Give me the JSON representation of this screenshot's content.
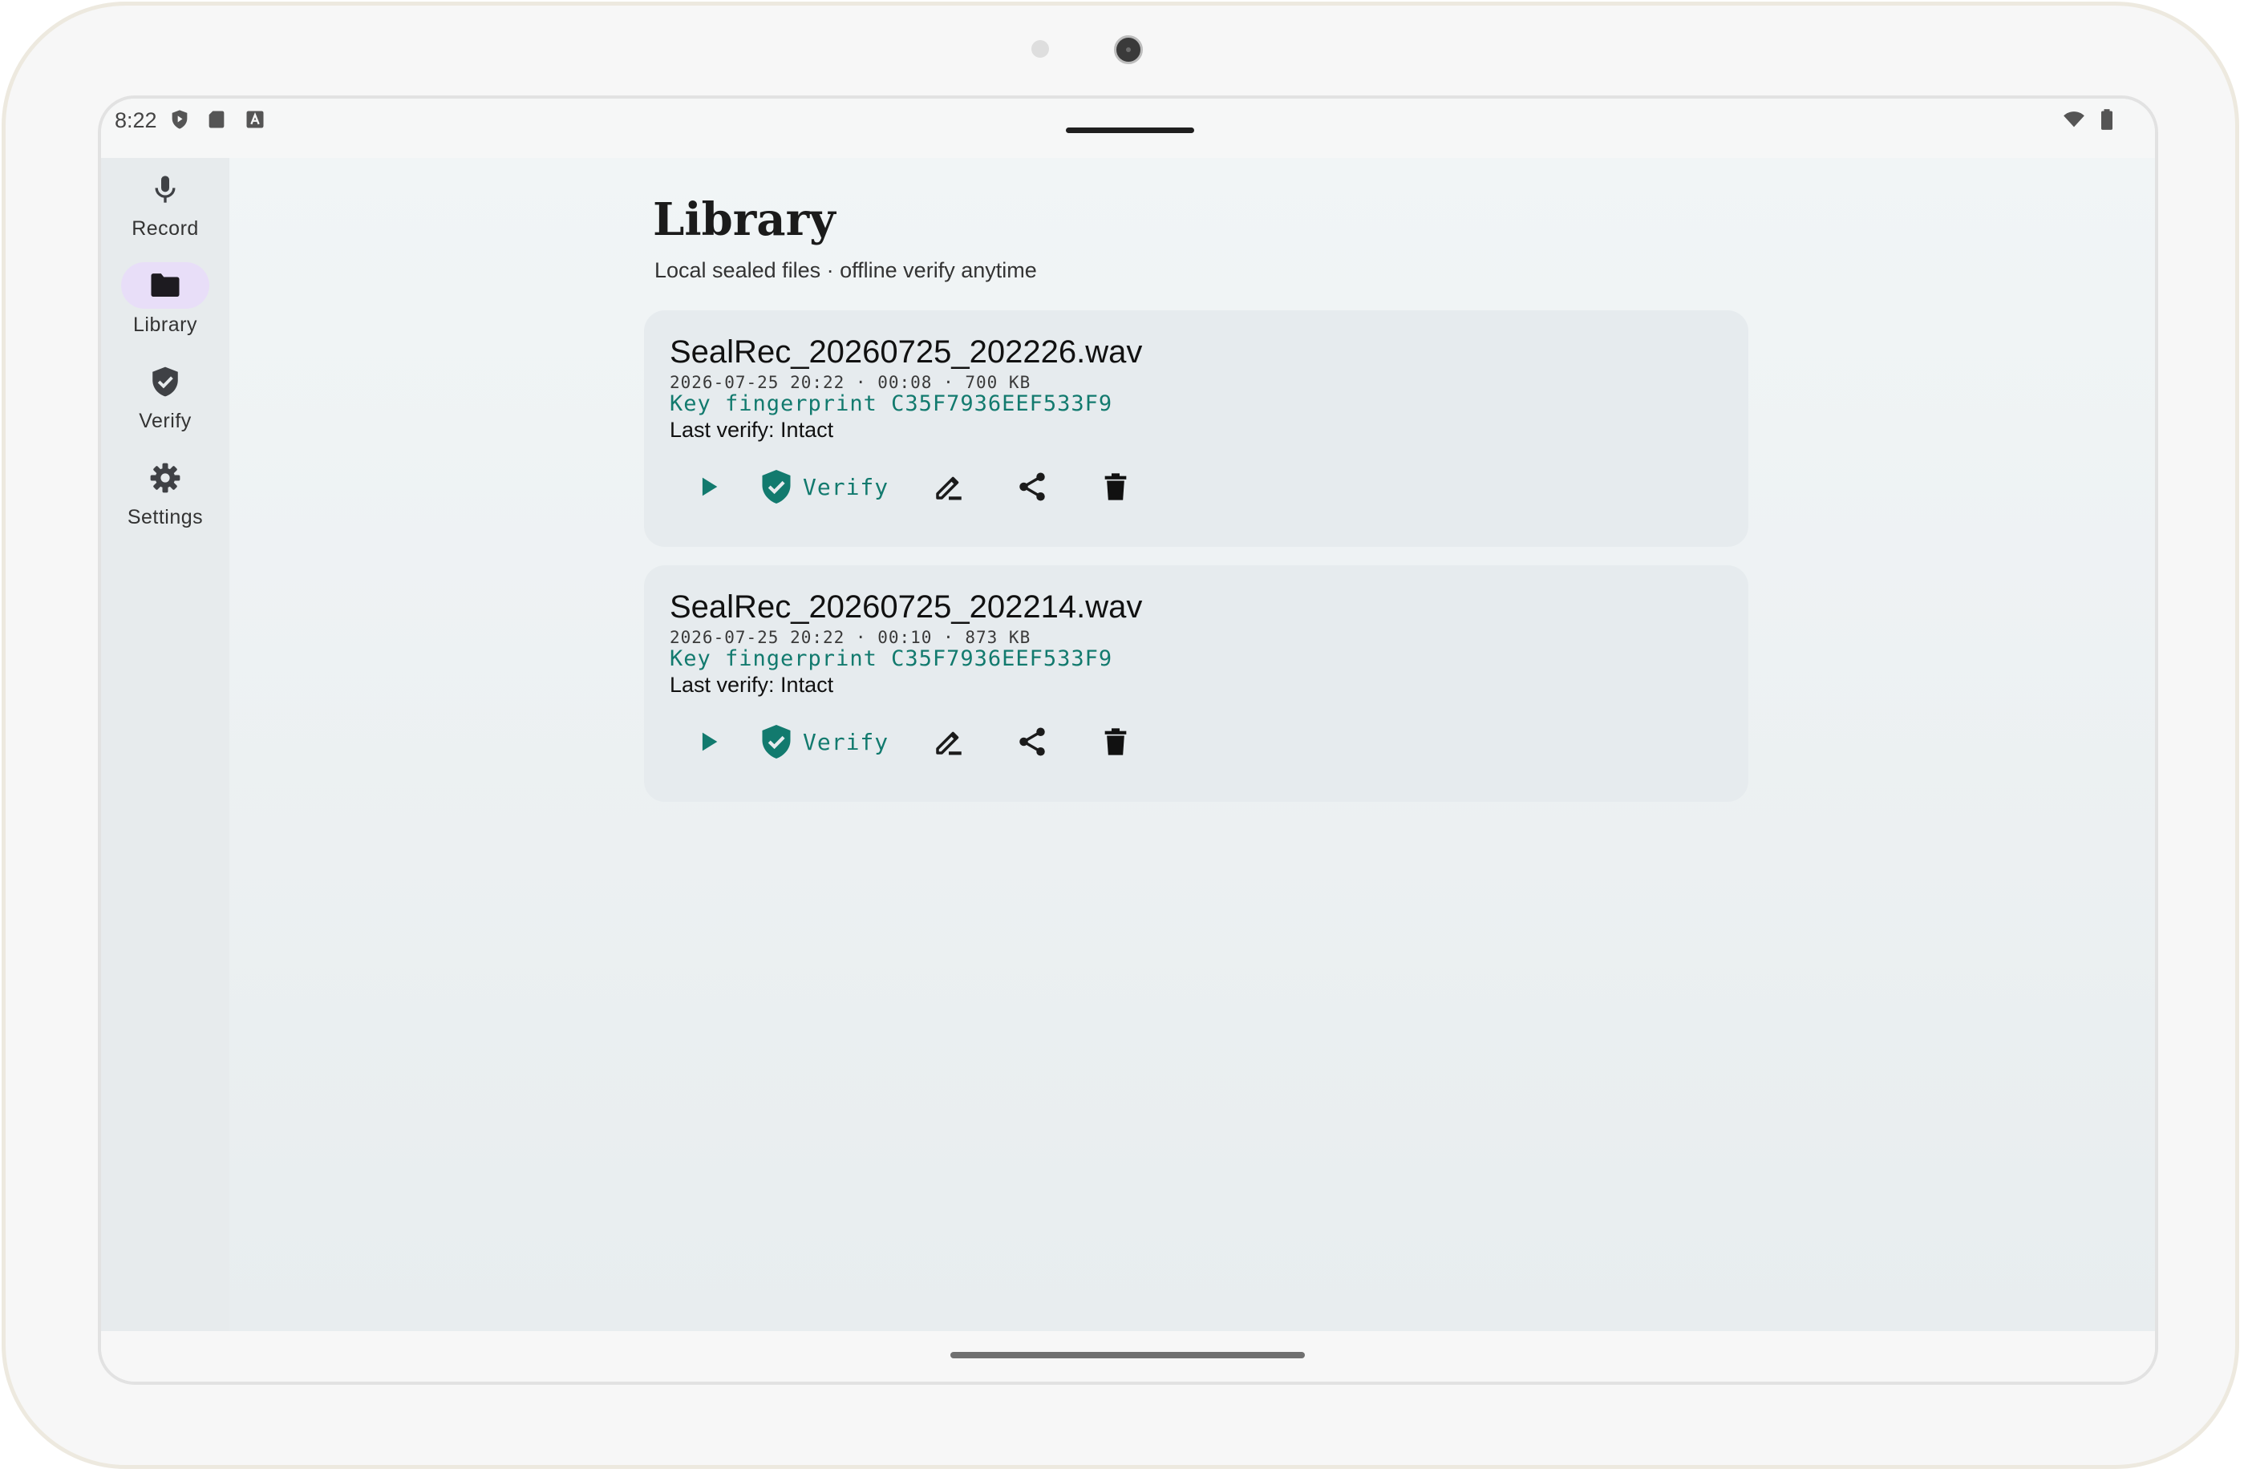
{
  "status_bar": {
    "time": "8:22"
  },
  "nav_rail": {
    "items": [
      {
        "label": "Record",
        "icon": "mic-icon",
        "active": false
      },
      {
        "label": "Library",
        "icon": "folder-icon",
        "active": true
      },
      {
        "label": "Verify",
        "icon": "shield-check-icon",
        "active": false
      },
      {
        "label": "Settings",
        "icon": "gear-icon",
        "active": false
      }
    ]
  },
  "page": {
    "title": "Library",
    "subtitle": "Local sealed files · offline verify anytime"
  },
  "recordings": [
    {
      "filename": "SealRec_20260725_202226.wav",
      "meta": "2026-07-25 20:22 · 00:08 · 700 KB",
      "key": "Key fingerprint C35F7936EEF533F9",
      "last_verify": "Last verify: Intact",
      "verify_label": "Verify"
    },
    {
      "filename": "SealRec_20260725_202214.wav",
      "meta": "2026-07-25 20:22 · 00:10 · 873 KB",
      "key": "Key fingerprint C35F7936EEF533F9",
      "last_verify": "Last verify: Intact",
      "verify_label": "Verify"
    }
  ],
  "colors": {
    "accent": "#127a6e",
    "rail_active": "#e8def8",
    "card_bg": "#e6ebee"
  }
}
